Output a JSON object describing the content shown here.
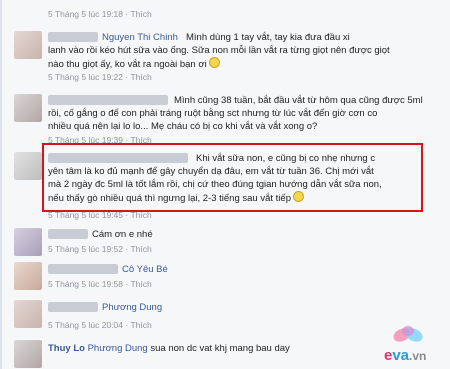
{
  "comments": [
    {
      "meta": {
        "date": "5 Tháng 5 lúc 19:18",
        "sep": "·",
        "like": "Thích"
      }
    },
    {
      "name": "Nguyen Thi Chinh",
      "lines": [
        "Mình dùng 1 tay vắt, tay kia đưa đầu xi",
        "lanh vào rồi kéo hút sữa vào ống. Sữa non mỗi lần vắt ra từng giọt nên được giọt",
        "nào thu giọt ấy, ko vắt ra ngoài bạn ơi"
      ],
      "meta": {
        "date": "5 Tháng 5 lúc 19:22",
        "sep": "·",
        "like": "Thích"
      }
    },
    {
      "lines": [
        "Mình cũng 38 tuần, bắt đầu vắt từ hôm qua cũng được 5ml",
        "rồi, cố gắng o để con phải tráng ruột bằng sct nhưng từ lúc vắt đến giờ cơn co",
        "nhiều quá nên lại lo lo... Mẹ cháu có bị co khi vắt và vắt xong o?"
      ],
      "meta": {
        "date": "5 Tháng 5 lúc 19:39",
        "sep": "·",
        "like": "Thích"
      }
    },
    {
      "lines": [
        "Khi vắt sữa non, e cũng bị co nhẹ nhưng c",
        "yên tâm là ko đủ mạnh để gây chuyển dạ đâu, em vắt từ tuần 36. Chị mới vắt",
        "mà 2 ngày đc 5ml là tốt lắm rồi, chị cứ theo đúng tgian hướng dẫn vắt sữa non,",
        "nếu thấy gò nhiều quá thì ngưng lại, 2-3 tiếng sau vắt tiếp"
      ],
      "meta": {
        "date": "5 Tháng 5 lúc 19:45",
        "sep": "·",
        "like": "Thích"
      }
    },
    {
      "lines": [
        "Cám ơn e nhé"
      ],
      "meta": {
        "date": "5 Tháng 5 lúc 19:52",
        "sep": "·",
        "like": "Thích"
      }
    },
    {
      "name": "Cô Yêu Bé",
      "meta": {
        "date": "5 Tháng 5 lúc 19:58",
        "sep": "·",
        "like": "Thích"
      }
    },
    {
      "name": "Phương Dung",
      "meta": {
        "date": "5 Tháng 5 lúc 20:04",
        "sep": "·",
        "like": "Thích"
      }
    },
    {
      "name": "Thuy Lo",
      "tag": "Phương Dung",
      "lines": [
        "sua non dc vat khj mang bau day"
      ]
    }
  ],
  "watermark": {
    "text": "eva.vn",
    "colors": {
      "e": "#e8306b",
      "va": "#2a9bd6",
      "vn": "#8a8a8a"
    }
  }
}
